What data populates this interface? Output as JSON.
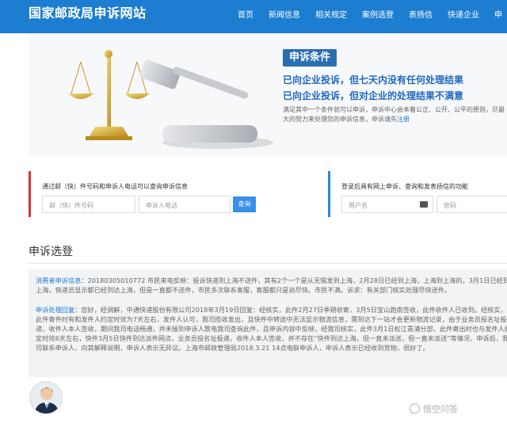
{
  "header": {
    "site_title": "国家邮政局申诉网站",
    "nav": [
      "首页",
      "新闻信息",
      "相关规定",
      "案例选登",
      "表扬信",
      "快递企业",
      "申"
    ]
  },
  "hero": {
    "badge": "申诉条件",
    "line1": "已向企业投诉，但七天内没有任何处理结果",
    "line2": "已向企业投诉，但对企业的处理结果不满意",
    "desc": "满足其中一个条件就可以申诉，申诉中心会本着公正、公开、公平的原则，尽最大的努力来处理您的申诉信息，申诉请先",
    "register": "注册"
  },
  "query": {
    "title": "通过邮（快）件号码和申诉人电话可以查询申诉信息",
    "tracking_placeholder": "邮（快）件号码",
    "phone_placeholder": "申诉人电话",
    "button": "查询"
  },
  "login": {
    "title": "登录后具有网上申诉、查询和发表扬信的功能",
    "username_placeholder": "用户名",
    "password_placeholder": "密码"
  },
  "section": {
    "title": "申诉选登",
    "msg1_label": "消费者申诉信息",
    "msg1_text": "：20180305010772 市民来电反映：投诉快递到上海不送件，其有2个一个是从无锡发到上海，2月28日已经到上海，上海到上海的，3月1日已经到上海，快递员显示都已经到达上海，但是一直都不送件，市民多次联系客服，客服都只是说尽快。市民不满。诉求：有关部门核实处理尽快送件。",
    "msg2_label": "申诉处理回复",
    "msg2_text": "：您好，经调解，中通快递股份有限公司2018年3月19日回复：经核实，此件2月27日季朔收寄，3月5日宝山跑南签收，此件收件人已收到。经核实，此件寄件时有和发件人约定时效为7天左右，发件人认可，我司揽收发出，且快件中转途中无法显示物流信息，需到达下一站才会更新物流记录，由于业务员投名址投递，收件人本人签收，期间我司电话畅通，并未接到申诉人致电我司查询此件，且申诉内容中反映，经我司核实，此件3月1日松江青浦分部，此件寄出时也与发件人约定时效6天左右，快件3月5日快件到达派件网点，业务员投名址投递，收件人本人签收，并不存在“快件到达上海，但一直未派送，但一直未派送”等情况，申诉后，我司联系申诉人，向其解释说明，申诉人表示无异议。上海市邮政管理局2018.3.21 14点电联申诉人，申诉人表示已经收到货物，很好了。"
  },
  "watermark": {
    "text": "悟空问答"
  }
}
